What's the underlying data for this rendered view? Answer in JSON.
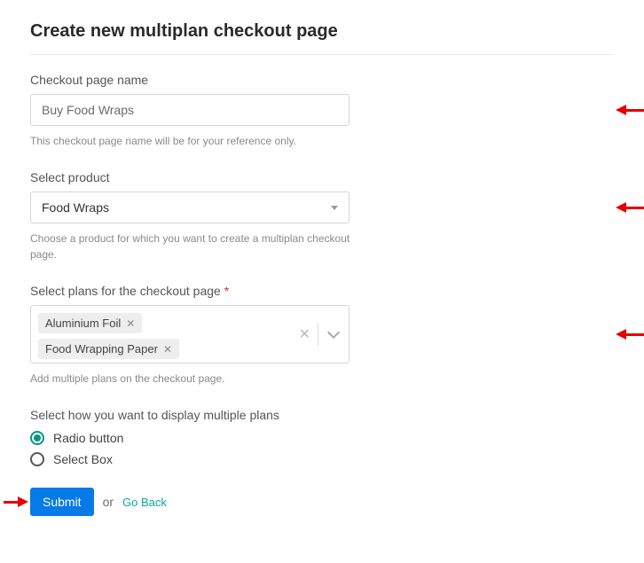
{
  "title": "Create new multiplan checkout page",
  "fields": {
    "checkout_name": {
      "label": "Checkout page name",
      "value": "Buy Food Wraps",
      "helper": "This checkout page name will be for your reference only."
    },
    "select_product": {
      "label": "Select product",
      "value": "Food Wraps",
      "helper": "Choose a product for which you want to create a multiplan checkout page."
    },
    "select_plans": {
      "label": "Select plans for the checkout page",
      "required_mark": "*",
      "tags": [
        "Aluminium Foil",
        "Food Wrapping Paper"
      ],
      "helper": "Add multiple plans on the checkout page."
    },
    "display_mode": {
      "label": "Select how you want to display multiple plans",
      "options": [
        "Radio button",
        "Select Box"
      ],
      "selected": "Radio button"
    }
  },
  "footer": {
    "submit": "Submit",
    "or": "or",
    "go_back": "Go Back"
  }
}
